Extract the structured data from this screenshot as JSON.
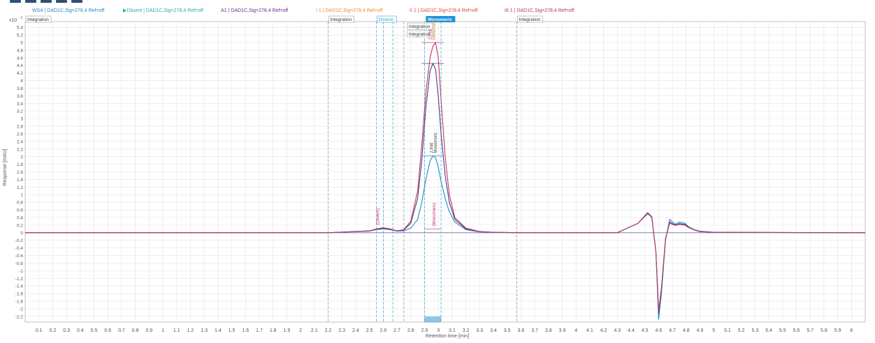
{
  "toolbar": {
    "icons": [
      "chart-tool-icon",
      "zoom-icon",
      "pan-icon",
      "reset-icon",
      "overlay-icon"
    ]
  },
  "legend": [
    {
      "label": "WSA | DAD1C,Sig=278,4 Ref=off",
      "color": "#1a8fc4"
    },
    {
      "label": "Diluent | DAD1C,Sig=278,4 Ref=off",
      "color": "#20b0b0",
      "marker": "▶"
    },
    {
      "label": "A1 | DAD1C,Sig=278,4 Ref=off",
      "color": "#6b2d8a"
    },
    {
      "label": "I 1 | DAD1C,Sig=278,4 Ref=off",
      "color": "#f08a28"
    },
    {
      "label": "II 1 | DAD1C,Sig=278,4 Ref=off",
      "color": "#e0463a"
    },
    {
      "label": "III 1 | DAD1C,Sig=278,4 Ref=off",
      "color": "#b03070"
    }
  ],
  "colors": {
    "grid": "#e4e4e4",
    "axis": "#9a9a9a",
    "highlight_fill": "#1e90d6",
    "event_line": "#8f8f8f",
    "dimeric_line": "#3aa0d8"
  },
  "chart_data": {
    "type": "line",
    "xlabel": "Retention time [min]",
    "ylabel": "Response [mAU]",
    "y_multiplier_label": "x10",
    "y_multiplier_exp": "-1",
    "xlim": [
      0,
      6.1
    ],
    "ylim": [
      -2.35,
      5.55
    ],
    "x_ticks": [
      0.1,
      0.2,
      0.3,
      0.4,
      0.5,
      0.6,
      0.7,
      0.8,
      0.9,
      1,
      1.1,
      1.2,
      1.3,
      1.4,
      1.5,
      1.6,
      1.7,
      1.8,
      1.9,
      2,
      2.1,
      2.2,
      2.3,
      2.4,
      2.5,
      2.6,
      2.7,
      2.8,
      2.9,
      3,
      3.1,
      3.2,
      3.3,
      3.4,
      3.5,
      3.6,
      3.7,
      3.8,
      3.9,
      4,
      4.1,
      4.2,
      4.3,
      4.4,
      4.5,
      4.6,
      4.7,
      4.8,
      4.9,
      5,
      5.1,
      5.2,
      5.3,
      5.4,
      5.5,
      5.6,
      5.7,
      5.8,
      5.9,
      6
    ],
    "x_tick_labels": [
      "0.1",
      "0.2",
      "0.3",
      "0.4",
      "0.5",
      "0.6",
      "0.7",
      "0.8",
      "0.9",
      "1",
      "1.1",
      "1.2",
      "1.3",
      "1.4",
      "1.5",
      "1.6",
      "1.7",
      "1.8",
      "1.9",
      "2",
      "2.1",
      "2.2",
      "2.3",
      "2.4",
      "2.5",
      "2.6",
      "2.7",
      "2.8",
      "2.9",
      "3",
      "3.1",
      "3.2",
      "3.3",
      "3.4",
      "3.5",
      "3.6",
      "3.7",
      "3.8",
      "3.9",
      "4",
      "4.1",
      "4.2",
      "4.3",
      "4.4",
      "4.5",
      "4.6",
      "4.7",
      "4.8",
      "4.9",
      "5",
      "5.1",
      "5.2",
      "5.3",
      "5.4",
      "5.5",
      "5.6",
      "5.7",
      "5.8",
      "5.9",
      "6"
    ],
    "y_ticks": [
      5.4,
      5.2,
      5,
      4.8,
      4.6,
      4.4,
      4.2,
      4,
      3.8,
      3.6,
      3.4,
      3.2,
      3,
      2.8,
      2.6,
      2.4,
      2.2,
      2,
      1.8,
      1.6,
      1.4,
      1.2,
      1,
      0.8,
      0.6,
      0.4,
      0.2,
      0,
      -0.2,
      -0.4,
      -0.6,
      -0.8,
      -1,
      -1.2,
      -1.4,
      -1.6,
      -1.8,
      -2,
      -2.2
    ],
    "y_tick_labels": [
      "5.4",
      "5.2",
      "5",
      "4.8",
      "4.6",
      "4.4",
      "4.2",
      "4",
      "3.8",
      "3.6",
      "3.4",
      "3.2",
      "3",
      "2.8",
      "2.6",
      "2.4",
      "2.2",
      "2",
      "1.8",
      "1.6",
      "1.4",
      "1.2",
      "1",
      "0.8",
      "0.6",
      "0.4",
      "0.2",
      "0",
      "-0.2",
      "-0.4",
      "-0.6",
      "-0.8",
      "-1",
      "-1.2",
      "-1.4",
      "-1.6",
      "-1.8",
      "-2",
      "-2.2"
    ],
    "grid": true,
    "series": [
      {
        "name": "WSA | DAD1C,Sig=278,4 Ref=off",
        "color": "#1a8fc4",
        "x": [
          0,
          2.2,
          2.5,
          2.55,
          2.6,
          2.65,
          2.7,
          2.75,
          2.8,
          2.85,
          2.88,
          2.91,
          2.94,
          2.96,
          2.98,
          3.0,
          3.02,
          3.05,
          3.08,
          3.12,
          3.2,
          3.3,
          3.4,
          3.6,
          4.3,
          4.45,
          4.52,
          4.55,
          4.58,
          4.6,
          4.62,
          4.65,
          4.68,
          4.72,
          4.75,
          4.79,
          4.82,
          4.86,
          4.9,
          5.0,
          6.1
        ],
        "y": [
          0,
          0,
          0.04,
          0.08,
          0.1,
          0.08,
          0.04,
          0.05,
          0.12,
          0.35,
          0.8,
          1.4,
          1.88,
          2.02,
          1.98,
          1.72,
          1.35,
          0.9,
          0.55,
          0.28,
          0.08,
          0.02,
          0.01,
          0,
          0,
          0.25,
          0.5,
          0.4,
          -0.5,
          -2.28,
          -1.6,
          -0.2,
          0.35,
          0.22,
          0.28,
          0.25,
          0.15,
          0.08,
          0.04,
          0.01,
          0
        ]
      },
      {
        "name": "A1 | DAD1C,Sig=278,4 Ref=off",
        "color": "#4b3a8c",
        "x": [
          0,
          2.2,
          2.5,
          2.55,
          2.6,
          2.65,
          2.7,
          2.75,
          2.8,
          2.85,
          2.88,
          2.91,
          2.94,
          2.96,
          2.98,
          3.0,
          3.02,
          3.05,
          3.08,
          3.12,
          3.2,
          3.3,
          3.4,
          3.6,
          4.3,
          4.45,
          4.52,
          4.55,
          4.58,
          4.6,
          4.62,
          4.65,
          4.68,
          4.72,
          4.75,
          4.79,
          4.82,
          4.86,
          4.9,
          5.0,
          6.1
        ],
        "y": [
          0,
          0,
          0.05,
          0.09,
          0.12,
          0.09,
          0.05,
          0.07,
          0.25,
          0.9,
          1.9,
          3.3,
          4.25,
          4.45,
          4.3,
          3.6,
          2.6,
          1.5,
          0.8,
          0.35,
          0.1,
          0.03,
          0.01,
          0,
          0,
          0.25,
          0.52,
          0.42,
          -0.5,
          -2.12,
          -1.5,
          -0.15,
          0.28,
          0.2,
          0.24,
          0.22,
          0.14,
          0.07,
          0.03,
          0.01,
          0
        ]
      },
      {
        "name": "III 1 | DAD1C,Sig=278,4 Ref=off",
        "color": "#c03a60",
        "x": [
          0,
          2.2,
          2.5,
          2.55,
          2.6,
          2.65,
          2.7,
          2.75,
          2.8,
          2.85,
          2.88,
          2.91,
          2.94,
          2.96,
          2.98,
          3.0,
          3.02,
          3.05,
          3.08,
          3.12,
          3.2,
          3.3,
          3.4,
          3.6,
          4.3,
          4.45,
          4.52,
          4.55,
          4.58,
          4.6,
          4.62,
          4.65,
          4.68,
          4.72,
          4.75,
          4.79,
          4.82,
          4.86,
          4.9,
          5.0,
          6.1
        ],
        "y": [
          0,
          0,
          0.05,
          0.1,
          0.13,
          0.1,
          0.05,
          0.08,
          0.3,
          1.1,
          2.3,
          3.7,
          4.6,
          4.9,
          5.0,
          4.6,
          3.5,
          2.0,
          1.0,
          0.4,
          0.12,
          0.03,
          0.01,
          0,
          0,
          0.25,
          0.53,
          0.42,
          -0.5,
          -2.05,
          -1.45,
          -0.15,
          0.25,
          0.19,
          0.22,
          0.2,
          0.13,
          0.07,
          0.03,
          0.01,
          0
        ]
      }
    ],
    "event_lines": [
      2.2,
      2.55,
      2.6,
      2.67,
      2.75,
      2.9,
      3.02,
      3.57
    ],
    "highlight_range": [
      2.9,
      3.02
    ],
    "annotations": {
      "integration_boxes": [
        {
          "x": 0.0,
          "label": "Integration"
        },
        {
          "x": 2.2,
          "label": "Integration"
        },
        {
          "x": 2.77,
          "label": "Integration"
        },
        {
          "x": 2.77,
          "label": "Integration"
        },
        {
          "x": 3.57,
          "label": "Integration"
        }
      ],
      "region_labels": [
        {
          "x": 2.56,
          "label": "Dimeric",
          "style": "dimeric"
        },
        {
          "x": 2.91,
          "label": "Monomeric",
          "style": "monomeric"
        }
      ],
      "peak_labels": [
        {
          "x": 2.96,
          "y_ref": 2.02,
          "label": "2.946",
          "color": "#444444"
        },
        {
          "x": 2.99,
          "y_ref": 2.02,
          "label": "Monomeric",
          "color": "#444444"
        },
        {
          "x": 2.95,
          "y_ref": 5.0,
          "label": "2.946",
          "color": "#c05060"
        },
        {
          "x": 2.98,
          "y_ref": 5.0,
          "label": "Monomeric",
          "color": "#e07a3a"
        },
        {
          "x": 2.57,
          "y_ref": 0.13,
          "label": "(Dimeric)",
          "color": "#c0306a"
        },
        {
          "x": 2.98,
          "y_ref": 0.1,
          "label": "(Monomeric)",
          "color": "#c0306a"
        }
      ]
    }
  }
}
